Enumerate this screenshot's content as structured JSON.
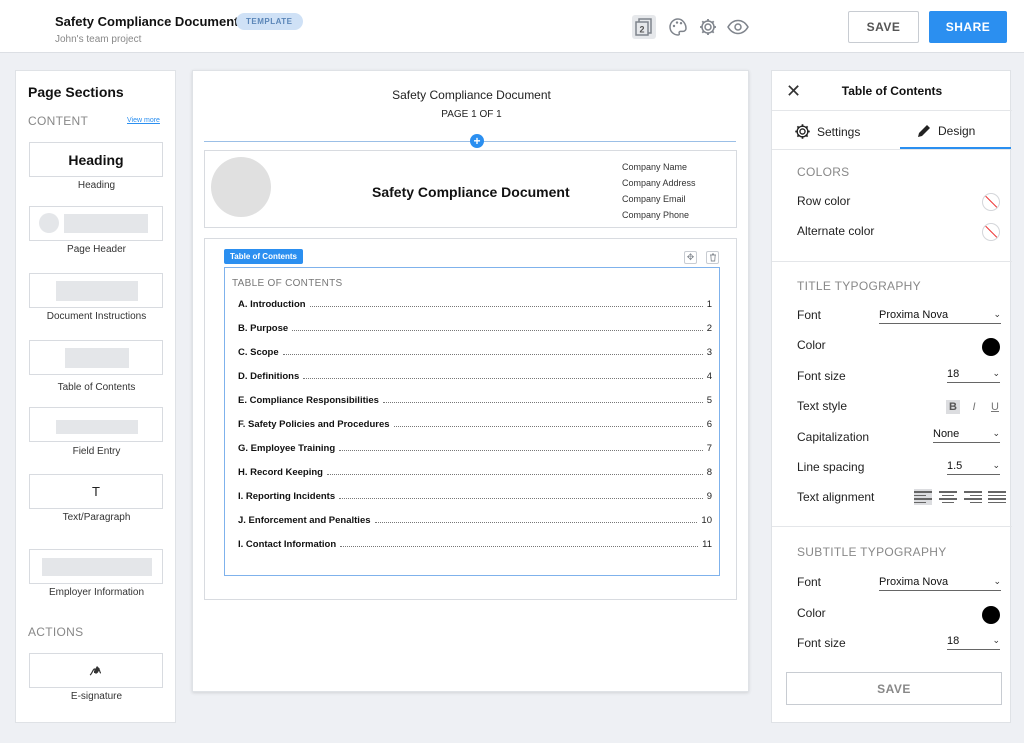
{
  "header": {
    "title": "Safety Compliance Document",
    "badge": "TEMPLATE",
    "subtitle": "John's team project",
    "pages_icon_number": "2",
    "save_label": "SAVE",
    "share_label": "SHARE"
  },
  "sidebar": {
    "title": "Page Sections",
    "content_label": "CONTENT",
    "view_more": "View more",
    "items": [
      {
        "label": "Heading",
        "tile_text": "Heading"
      },
      {
        "label": "Page Header"
      },
      {
        "label": "Document Instructions"
      },
      {
        "label": "Table of Contents"
      },
      {
        "label": "Field Entry"
      },
      {
        "label": "Text/Paragraph",
        "tile_text": "T"
      },
      {
        "label": "Employer Information"
      }
    ],
    "actions_label": "ACTIONS",
    "actions": [
      {
        "label": "E-signature"
      }
    ]
  },
  "canvas": {
    "doc_title": "Safety Compliance Document",
    "page_indicator": "PAGE 1 OF 1",
    "header_title": "Safety Compliance Document",
    "company_info": [
      "Company Name",
      "Company Address",
      "Company Email",
      "Company Phone"
    ],
    "toc_tag": "Table of Contents",
    "toc_heading": "TABLE OF CONTENTS",
    "toc_entries": [
      {
        "title": "A. Introduction",
        "page": "1"
      },
      {
        "title": "B. Purpose",
        "page": "2"
      },
      {
        "title": "C. Scope",
        "page": "3"
      },
      {
        "title": "D. Definitions",
        "page": "4"
      },
      {
        "title": "E. Compliance Responsibilities",
        "page": "5"
      },
      {
        "title": "F. Safety Policies and Procedures",
        "page": "6"
      },
      {
        "title": "G. Employee Training",
        "page": "7"
      },
      {
        "title": "H. Record Keeping",
        "page": "8"
      },
      {
        "title": "I. Reporting Incidents",
        "page": "9"
      },
      {
        "title": "J. Enforcement and Penalties",
        "page": "10"
      },
      {
        "title": "I. Contact Information",
        "page": "11"
      }
    ]
  },
  "panel": {
    "title": "Table of Contents",
    "tabs": [
      "Settings",
      "Design"
    ],
    "active_tab": "Design",
    "colors_label": "COLORS",
    "row_color_label": "Row color",
    "alternate_color_label": "Alternate color",
    "title_typography_label": "TITLE TYPOGRAPHY",
    "subtitle_typography_label": "SUBTITLE TYPOGRAPHY",
    "font_label": "Font",
    "color_label": "Color",
    "font_size_label": "Font size",
    "text_style_label": "Text style",
    "capitalization_label": "Capitalization",
    "line_spacing_label": "Line spacing",
    "text_alignment_label": "Text alignment",
    "title_font": "Proxima Nova",
    "title_font_size": "18",
    "title_capitalization": "None",
    "title_line_spacing": "1.5",
    "title_color": "#000000",
    "subtitle_font": "Proxima Nova",
    "subtitle_font_size": "18",
    "subtitle_color": "#000000",
    "text_style_buttons": [
      "B",
      "I",
      "U"
    ],
    "save_label": "SAVE"
  },
  "colors": {
    "accent": "#2b8ff0",
    "badge_bg": "#cfe1f6"
  }
}
